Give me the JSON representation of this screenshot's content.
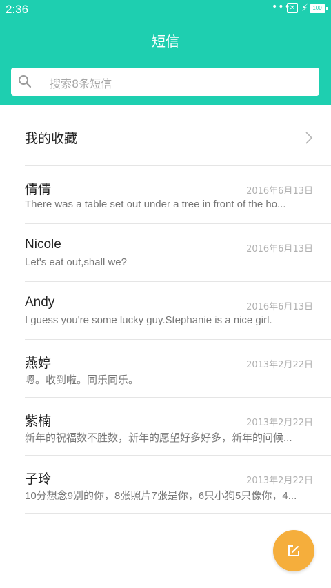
{
  "status_bar": {
    "time": "2:36",
    "dots": "•••",
    "battery": "100"
  },
  "header": {
    "title": "短信",
    "accent_color": "#1ecfb0"
  },
  "search": {
    "placeholder": "搜索8条短信",
    "icon": "search-icon"
  },
  "favorites": {
    "label": "我的收藏",
    "icon": "chevron-right-icon"
  },
  "conversations": [
    {
      "name": "倩倩",
      "date": "2016年6月13日",
      "preview": "There was a table set out under a tree in front of the ho..."
    },
    {
      "name": "Nicole",
      "date": "2016年6月13日",
      "preview": "Let's eat out,shall we?"
    },
    {
      "name": "Andy",
      "date": "2016年6月13日",
      "preview": "I guess you're some lucky guy.Stephanie is a nice girl."
    },
    {
      "name": "燕婷",
      "date": "2013年2月22日",
      "preview": "嗯。收到啦。同乐同乐。"
    },
    {
      "name": "紫楠",
      "date": "2013年2月22日",
      "preview": "新年的祝福数不胜数，新年的愿望好多好多，新年的问候..."
    },
    {
      "name": "子玲",
      "date": "2013年2月22日",
      "preview": "10分想念9别的你，8张照片7张是你，6只小狗5只像你，4..."
    }
  ],
  "compose_button": {
    "icon": "compose-icon",
    "color": "#f5ae3c"
  }
}
